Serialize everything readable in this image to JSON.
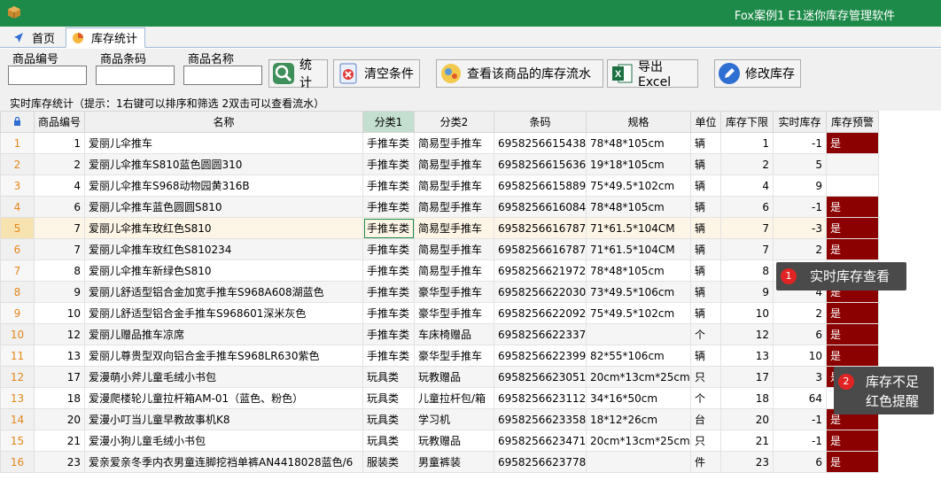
{
  "window": {
    "title": "Fox案例1 E1迷你库存管理软件"
  },
  "tabs": [
    {
      "label": "首页"
    },
    {
      "label": "库存统计"
    }
  ],
  "filters": {
    "code_label": "商品编号",
    "code_value": "",
    "barcode_label": "商品条码",
    "barcode_value": "",
    "name_label": "商品名称",
    "name_value": ""
  },
  "toolbar": {
    "stats_label": "统计",
    "clear_label": "清空条件",
    "flow_label": "查看该商品的库存流水",
    "export_label": "导出Excel",
    "edit_label": "修改库存"
  },
  "hint": "实时库存统计（提示：1右键可以排序和筛选 2双击可以查看流水）",
  "table": {
    "columns": [
      "",
      "商品编号",
      "名称",
      "分类1",
      "分类2",
      "条码",
      "规格",
      "单位",
      "库存下限",
      "实时库存",
      "库存预警"
    ],
    "rows": [
      [
        "1",
        "1",
        "爱丽儿伞推车",
        "手推车类",
        "简易型手推车",
        "6958256615438",
        "78*48*105cm",
        "辆",
        "1",
        "-1",
        "是"
      ],
      [
        "2",
        "2",
        "爱丽儿伞推车S810蓝色圆圆310",
        "手推车类",
        "简易型手推车",
        "6958256615636",
        "19*18*105cm",
        "辆",
        "2",
        "5",
        ""
      ],
      [
        "3",
        "4",
        "爱丽儿伞推车S968动物园黄316B",
        "手推车类",
        "简易型手推车",
        "6958256615889",
        "75*49.5*102cm",
        "辆",
        "4",
        "9",
        ""
      ],
      [
        "4",
        "6",
        "爱丽儿伞推车蓝色圆圆S810",
        "手推车类",
        "简易型手推车",
        "6958256616084",
        "78*48*105cm",
        "辆",
        "6",
        "-1",
        "是"
      ],
      [
        "5",
        "7",
        "爱丽儿伞推车玫红色S810",
        "手推车类",
        "简易型手推车",
        "6958256616787",
        "71*61.5*104CM",
        "辆",
        "7",
        "-3",
        "是"
      ],
      [
        "6",
        "7",
        "爱丽儿伞推车玫红色S810234",
        "手推车类",
        "简易型手推车",
        "6958256616787",
        "71*61.5*104CM",
        "辆",
        "7",
        "2",
        "是"
      ],
      [
        "7",
        "8",
        "爱丽儿伞推车新绿色S810",
        "手推车类",
        "简易型手推车",
        "6958256621972",
        "78*48*105cm",
        "辆",
        "8",
        "",
        ""
      ],
      [
        "8",
        "9",
        "爱丽儿舒适型铝合金加宽手推车S968A608湖蓝色",
        "手推车类",
        "豪华型手推车",
        "6958256622030",
        "73*49.5*106cm",
        "辆",
        "9",
        "4",
        "是"
      ],
      [
        "9",
        "10",
        "爱丽儿舒适型铝合金手推车S968601深米灰色",
        "手推车类",
        "豪华型手推车",
        "6958256622092",
        "75*49.5*102cm",
        "辆",
        "10",
        "2",
        "是"
      ],
      [
        "10",
        "12",
        "爱丽儿赠品推车凉席",
        "手推车类",
        "车床椅赠品",
        "6958256622337",
        "",
        "个",
        "12",
        "6",
        "是"
      ],
      [
        "11",
        "13",
        "爱丽儿尊贵型双向铝合金手推车S968LR630紫色",
        "手推车类",
        "豪华型手推车",
        "6958256622399",
        "82*55*106cm",
        "辆",
        "13",
        "10",
        "是"
      ],
      [
        "12",
        "17",
        "爱漫萌小斧儿童毛绒小书包",
        "玩具类",
        "玩教赠品",
        "6958256623051",
        "20cm*13cm*25cm",
        "只",
        "17",
        "3",
        "是"
      ],
      [
        "13",
        "18",
        "爱漫爬楼轮儿童拉杆箱AM-01（蓝色、粉色）",
        "玩具类",
        "儿童拉杆包/箱",
        "6958256623112",
        "34*16*50cm",
        "个",
        "18",
        "64",
        ""
      ],
      [
        "14",
        "20",
        "爱漫小叮当儿童早教故事机K8",
        "玩具类",
        "学习机",
        "6958256623358",
        "18*12*26cm",
        "台",
        "20",
        "-1",
        "是"
      ],
      [
        "15",
        "21",
        "爱漫小狗儿童毛绒小书包",
        "玩具类",
        "玩教赠品",
        "6958256623471",
        "20cm*13cm*25cm",
        "只",
        "21",
        "-1",
        "是"
      ],
      [
        "16",
        "23",
        "爱亲爱亲冬季内衣男童连脚挖裆单裤AN4418028蓝色/6",
        "服装类",
        "男童裤装",
        "6958256623778",
        "",
        "件",
        "23",
        "6",
        "是"
      ]
    ]
  },
  "callouts": [
    {
      "num": "1",
      "text": "实时库存查看"
    },
    {
      "num": "2",
      "text": "库存不足",
      "text2": "红色提醒"
    }
  ]
}
